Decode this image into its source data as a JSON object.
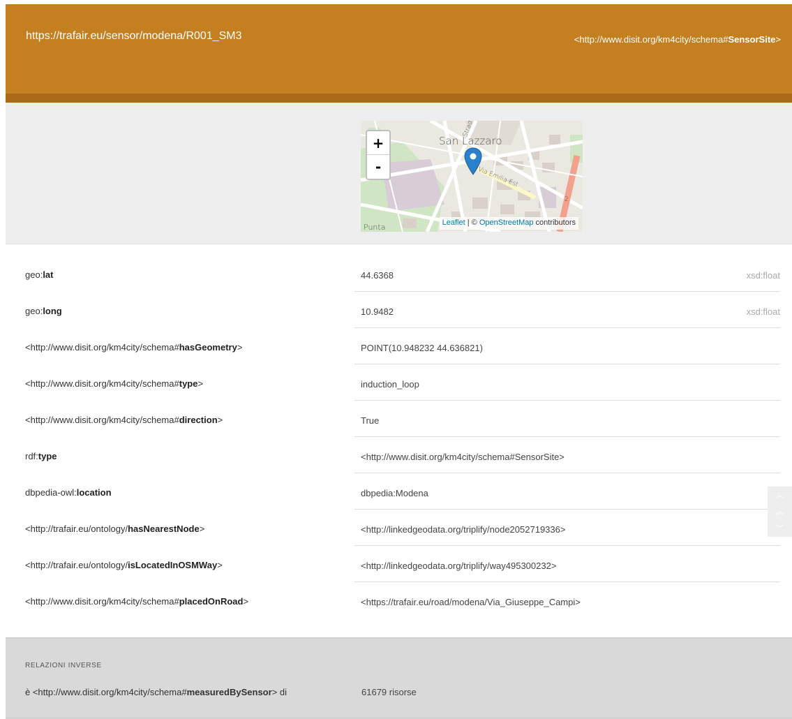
{
  "header": {
    "uri": "https://trafair.eu/sensor/modena/R001_SM3",
    "type_prefix": "<http://www.disit.org/km4city/schema#",
    "type_local": "SensorSite",
    "type_suffix": ">"
  },
  "map": {
    "zoom_in": "+",
    "zoom_out": "-",
    "attribution_leaflet": "Leaflet",
    "attribution_sep": " | © ",
    "attribution_osm": "OpenStreetMap",
    "attribution_tail": " contributors",
    "place_label": "San Lazzaro",
    "street_label": "Via Emilia Est",
    "street_label_2": "Strada",
    "area_label": "Punta",
    "road_number": "2",
    "marker_icon": "map-marker-icon"
  },
  "properties": [
    {
      "pred_prefix": "geo:",
      "pred_local": "lat",
      "pred_suffix": "",
      "value": "44.6368",
      "datatype": "xsd:float"
    },
    {
      "pred_prefix": "geo:",
      "pred_local": "long",
      "pred_suffix": "",
      "value": "10.9482",
      "datatype": "xsd:float"
    },
    {
      "pred_prefix": "<http://www.disit.org/km4city/schema#",
      "pred_local": "hasGeometry",
      "pred_suffix": ">",
      "value": "POINT(10.948232 44.636821)",
      "datatype": ""
    },
    {
      "pred_prefix": "<http://www.disit.org/km4city/schema#",
      "pred_local": "type",
      "pred_suffix": ">",
      "value": "induction_loop",
      "datatype": ""
    },
    {
      "pred_prefix": "<http://www.disit.org/km4city/schema#",
      "pred_local": "direction",
      "pred_suffix": ">",
      "value": "True",
      "datatype": ""
    },
    {
      "pred_prefix": "rdf:",
      "pred_local": "type",
      "pred_suffix": "",
      "value": "<http://www.disit.org/km4city/schema#SensorSite>",
      "datatype": ""
    },
    {
      "pred_prefix": "dbpedia-owl:",
      "pred_local": "location",
      "pred_suffix": "",
      "value": "dbpedia:Modena",
      "datatype": ""
    },
    {
      "pred_prefix": "<http://trafair.eu/ontology/",
      "pred_local": "hasNearestNode",
      "pred_suffix": ">",
      "value": "<http://linkedgeodata.org/triplify/node2052719336>",
      "datatype": ""
    },
    {
      "pred_prefix": "<http://trafair.eu/ontology/",
      "pred_local": "isLocatedInOSMWay",
      "pred_suffix": ">",
      "value": "<http://linkedgeodata.org/triplify/way495300232>",
      "datatype": ""
    },
    {
      "pred_prefix": "<http://www.disit.org/km4city/schema#",
      "pred_local": "placedOnRoad",
      "pred_suffix": ">",
      "value": "<https://trafair.eu/road/modena/Via_Giuseppe_Campi>",
      "datatype": ""
    }
  ],
  "scroll": {
    "up": "︿",
    "top": "︽",
    "down": "﹀"
  },
  "inverse": {
    "title": "RELAZIONI INVERSE",
    "rel_prefix": "è <http://www.disit.org/km4city/schema#",
    "rel_local": "measuredBySensor",
    "rel_suffix": "> di",
    "count": "61679 risorse"
  },
  "colors": {
    "header": "#c47f21",
    "header_border": "#a86a19",
    "marker": "#2a81cb",
    "link": "#0078a8"
  }
}
